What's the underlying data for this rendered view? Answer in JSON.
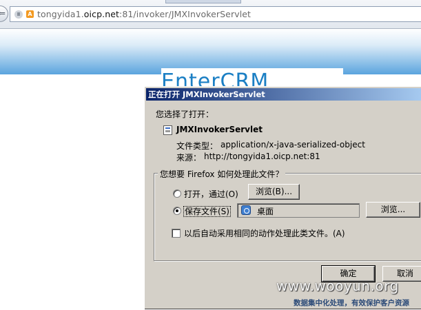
{
  "browser": {
    "url_host_prefix": "tongyida1.",
    "url_host_main": "oicp.net",
    "url_rest": ":81/invoker/JMXInvokerServlet",
    "back_glyph": "⇐",
    "site_icon_glyph": "A"
  },
  "page": {
    "logo_text": "EnterCRM"
  },
  "dialog": {
    "title": "正在打开 JMXInvokerServlet",
    "intro": "您选择了打开：",
    "file_name": "JMXInvokerServlet",
    "file_type_label": "文件类型：",
    "file_type_value": "application/x-java-serialized-object",
    "source_label": "来源：",
    "source_value": "http://tongyida1.oicp.net:81",
    "group_title": "您想要 Firefox 如何处理此文件？",
    "open_with_label": "打开，通过(O)",
    "open_with_checked": false,
    "browse_button_1": "浏览(B)...",
    "save_file_label": "保存文件(S)",
    "save_file_checked": true,
    "save_folder": "桌面",
    "browse_button_2": "浏览...",
    "auto_action_label": "以后自动采用相同的动作处理此类文件。(A)",
    "auto_action_checked": false,
    "ok_button": "确定",
    "cancel_button": "取消"
  },
  "watermark": {
    "main": "www.wooyun.org",
    "sub": "数据集中化处理，有效保护客户资源"
  }
}
